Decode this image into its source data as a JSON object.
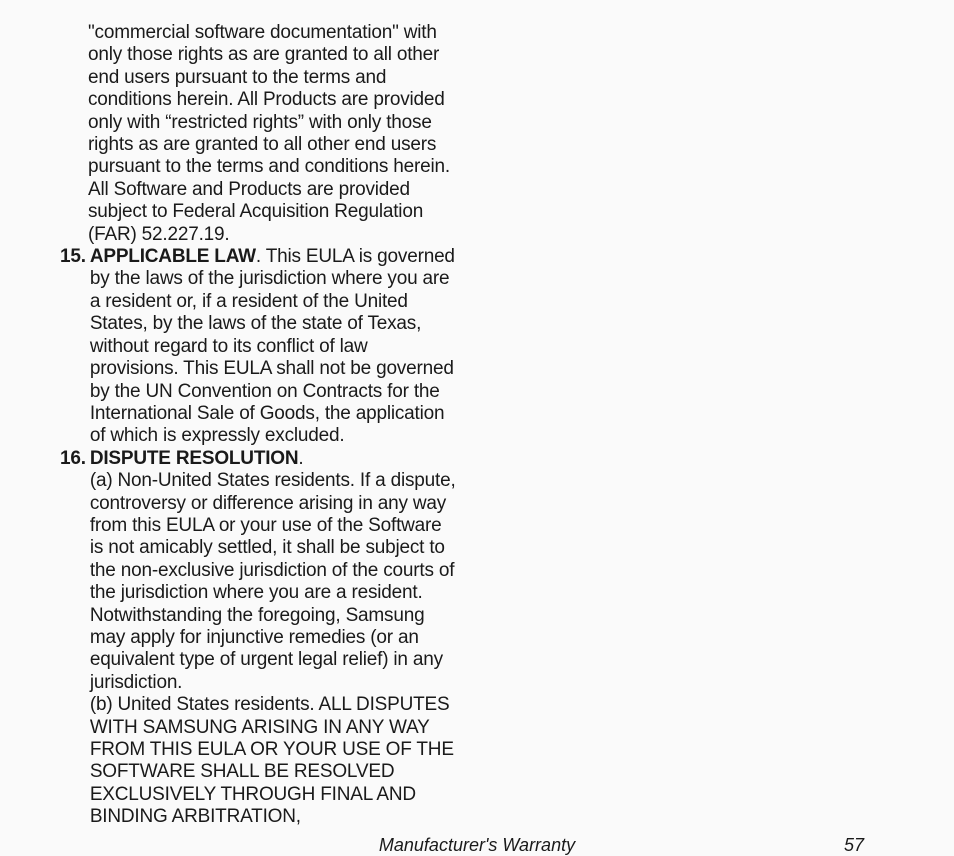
{
  "footer": {
    "title": "Manufacturer's Warranty",
    "page": "57"
  },
  "items": {
    "continued_14": "\"commercial software documentation\" with only those rights as are granted to all other end users pursuant to the terms and conditions herein.  All Products are provided only with “restricted rights” with only those rights as are granted to all other end users pursuant to the terms and conditions herein.  All Software and Products are provided subject to Federal Acquisition Regulation (FAR) 52.227.19.",
    "n15": {
      "number": "15.",
      "heading": "APPLICABLE LAW",
      "text": ". This EULA is governed by the laws of the jurisdiction where you are a resident or, if a resident of the United States, by the laws of the state of Texas, without regard to its conflict of law provisions. This EULA shall not be governed by the UN Convention on Contracts for the International Sale of Goods, the application of which is expressly excluded."
    },
    "n16": {
      "number": "16.",
      "heading": "DISPUTE RESOLUTION",
      "text_a": "(a) Non-United States residents.  If a dispute, controversy or difference arising in any way from this EULA or your use of the Software is not amicably settled, it shall be subject to the non-exclusive jurisdiction of the courts of the jurisdiction where you are a resident. Notwithstanding the foregoing, Samsung may apply for injunctive remedies (or an equivalent type of urgent legal relief) in any jurisdiction.",
      "text_b": "(b) United States residents.  ALL DISPUTES WITH SAMSUNG ARISING IN ANY WAY FROM THIS EULA OR YOUR USE OF THE SOFTWARE SHALL BE RESOLVED EXCLUSIVELY THROUGH FINAL AND BINDING ARBITRATION,"
    }
  }
}
